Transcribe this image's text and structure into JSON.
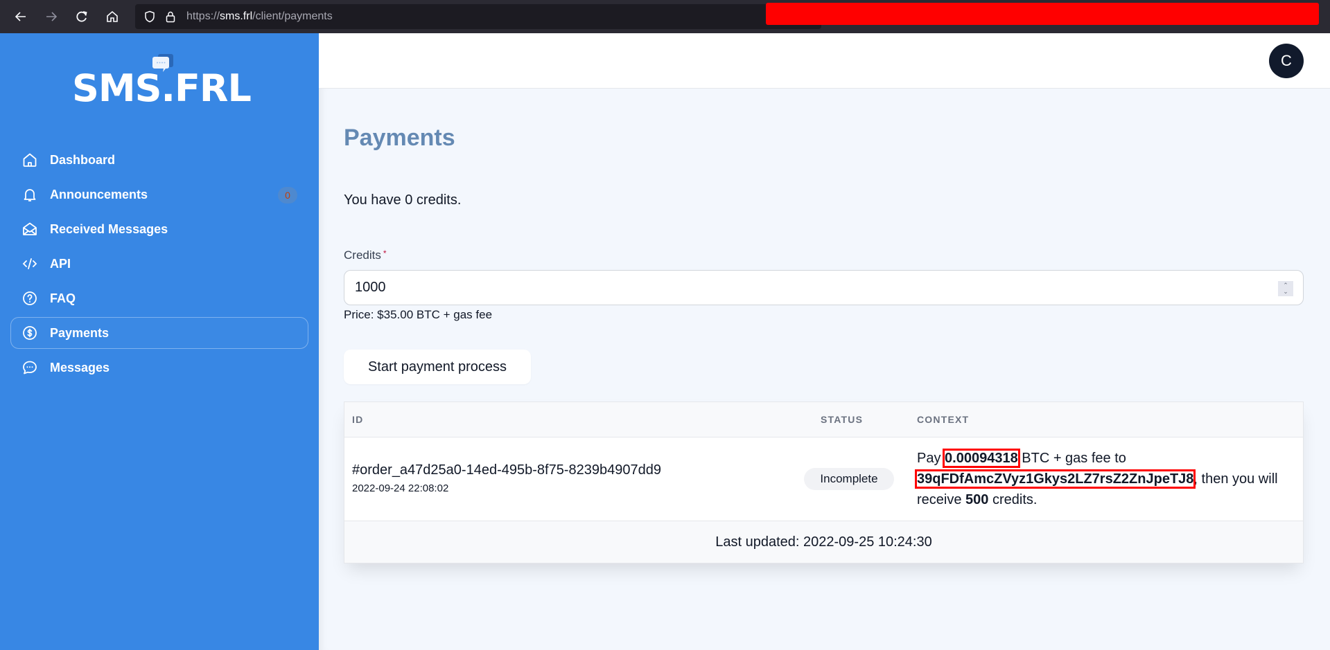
{
  "browser": {
    "url_prefix": "https://",
    "url_host": "sms.frl",
    "url_path": "/client/payments"
  },
  "brand": {
    "logo_text": "SMS.FRL",
    "sidebar_color": "#3887e4"
  },
  "sidebar": {
    "items": [
      {
        "label": "Dashboard",
        "icon": "home-icon"
      },
      {
        "label": "Announcements",
        "icon": "bell-icon",
        "badge": "0"
      },
      {
        "label": "Received Messages",
        "icon": "envelope-open-icon"
      },
      {
        "label": "API",
        "icon": "code-icon"
      },
      {
        "label": "FAQ",
        "icon": "question-circle-icon"
      },
      {
        "label": "Payments",
        "icon": "dollar-circle-icon",
        "active": true
      },
      {
        "label": "Messages",
        "icon": "chat-bubble-icon"
      }
    ]
  },
  "header": {
    "avatar_initial": "C"
  },
  "main": {
    "title": "Payments",
    "credits_text": "You have 0 credits.",
    "credits_field": {
      "label": "Credits",
      "required_mark": "*",
      "value": "1000"
    },
    "price_text": "Price: $35.00 BTC + gas fee",
    "start_button": "Start payment process",
    "table": {
      "columns": [
        "ID",
        "STATUS",
        "CONTEXT"
      ],
      "rows": [
        {
          "id": "#order_a47d25a0-14ed-495b-8f75-8239b4907dd9",
          "date": "2022-09-24 22:08:02",
          "status": "Incomplete",
          "context": {
            "pre": "Pay ",
            "amount": "0.00094318",
            "mid": " BTC + gas fee to ",
            "address": "39qFDfAmcZVyz1Gkys2LZ7rsZ2ZnJpeTJ8",
            "post1": ", then you will receive ",
            "credits": "500",
            "post2": " credits."
          }
        }
      ],
      "footer": "Last updated: 2022-09-25 10:24:30"
    }
  }
}
